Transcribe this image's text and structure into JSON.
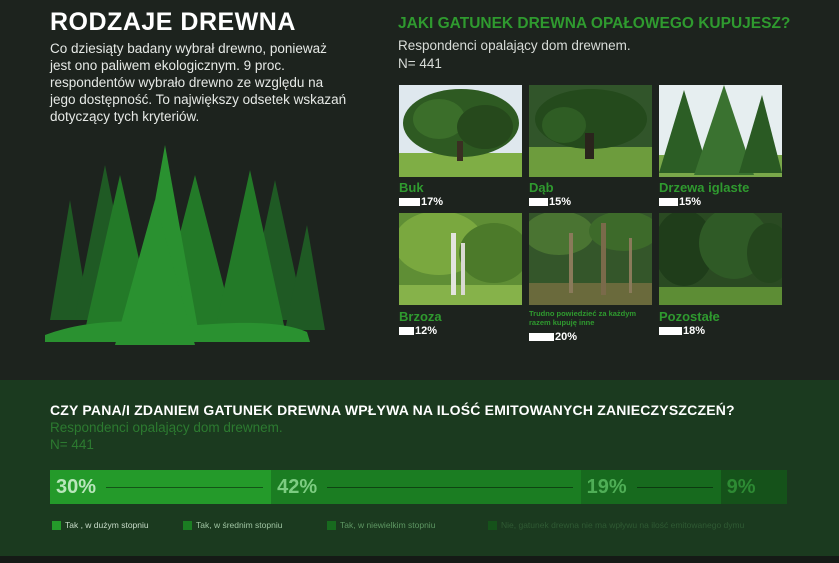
{
  "left": {
    "title": "RODZAJE DREWNA",
    "text": "Co dziesiąty badany wybrał drewno, ponieważ jest ono paliwem ekologicznym. 9 proc. respondentów wybrało drewno ze względu na jego dostępność. To największy odsetek wskazań dotyczący tych kryteriów."
  },
  "top_chart": {
    "question": "JAKI GATUNEK DREWNA OPAŁOWEGO KUPUJESZ?",
    "subtitle": "Respondenci opalający dom drewnem.",
    "n": "N= 441"
  },
  "bottom_chart": {
    "question": "CZY PANA/I ZDANIEM GATUNEK DREWNA WPŁYWA NA ILOŚĆ EMITOWANYCH ZANIECZYSZCZEŃ?",
    "subtitle": "Respondenci opalający dom drewnem.",
    "n": "N= 441"
  },
  "chart_data": [
    {
      "type": "bar",
      "title": "JAKI GATUNEK DREWNA OPAŁOWEGO KUPUJESZ?",
      "categories": [
        "Buk",
        "Dąb",
        "Drzewa iglaste",
        "Brzoza",
        "Trudno powiedzieć za każdym razem kupuję inne",
        "Pozostałe"
      ],
      "values": [
        17,
        15,
        15,
        12,
        20,
        18
      ],
      "labels": [
        "17%",
        "15%",
        "15%",
        "12%",
        "20%",
        "18%"
      ],
      "unit": "%"
    },
    {
      "type": "bar",
      "title": "CZY PANA/I ZDANIEM GATUNEK DREWNA WPŁYWA NA ILOŚĆ EMITOWANYCH ZANIECZYSZCZEŃ?",
      "stacked": true,
      "categories": [
        "Tak , w dużym stopniu",
        "Tak, w średnim stopniu",
        "Tak, w niewielkim stopniu",
        "Nie, gatunek drewna nie ma wpływu na ilość emitowanego dymu"
      ],
      "values": [
        30,
        42,
        19,
        9
      ],
      "labels": [
        "30%",
        "42%",
        "19%",
        "9%"
      ],
      "colors": [
        "#249a2a",
        "#1b7d22",
        "#176a1e",
        "#15521a"
      ],
      "label_colors": [
        "#b9e6bb",
        "#7ccc81",
        "#4fae56",
        "#2d8a33"
      ],
      "legend_text_colors": [
        "#c8dcc9",
        "#9fc4a2",
        "#5d9662",
        "#2f5a33"
      ],
      "legend_position": "bottom"
    }
  ]
}
